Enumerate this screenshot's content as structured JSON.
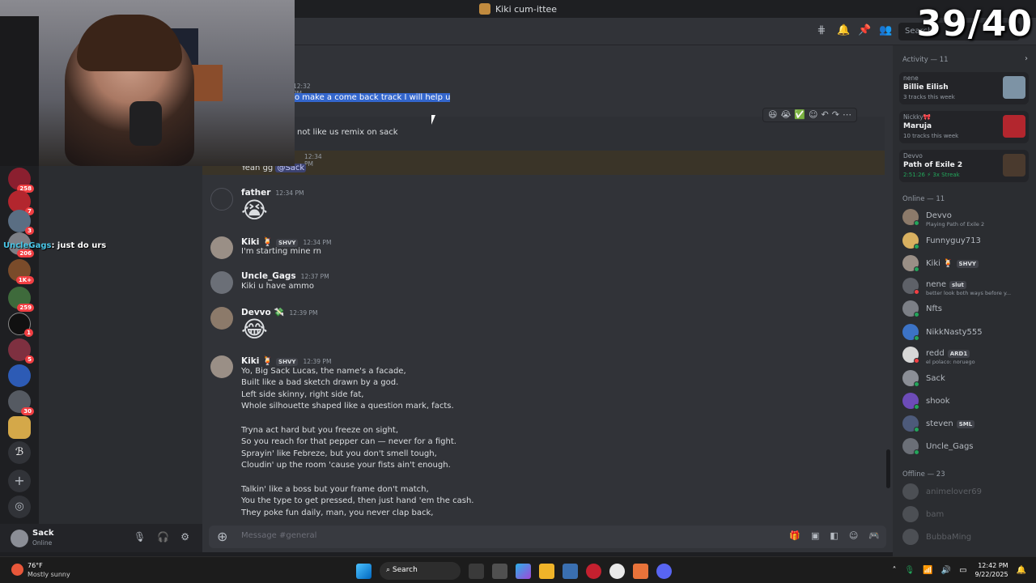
{
  "window": {
    "title": "Kiki cum-ittee"
  },
  "stream_counter": "39/40",
  "stream_chat": {
    "user": "UncleGags",
    "text": ": just do urs"
  },
  "header": {
    "search_placeholder": "Search"
  },
  "servers": [
    {
      "badge": "258"
    },
    {
      "badge": "7"
    },
    {
      "badge": "3"
    },
    {
      "badge": "206"
    },
    {
      "badge": "1K+"
    },
    {
      "badge": "259"
    },
    {
      "badge": "1"
    },
    {
      "badge": "5"
    },
    {
      "badge": ""
    },
    {
      "badge": "30"
    },
    {
      "badge": ""
    }
  ],
  "messages": {
    "partial1": {
      "time": "12:32 PM",
      "text": "o make a come back track I will help u"
    },
    "partial2": {
      "text": "not like us remix on sack"
    },
    "partial3": {
      "time": "12:34 PM",
      "text": "Yeah gg ",
      "mention": "@Sack"
    },
    "m1": {
      "author": "father",
      "time": "12:34 PM",
      "emoji": "😭"
    },
    "m2": {
      "author": "Kiki 🍹",
      "tag": "SHVY",
      "time": "12:34 PM",
      "text": "I'm starting mine rn"
    },
    "m3": {
      "author": "Uncle_Gags",
      "time": "12:37 PM",
      "text": "Kiki u have ammo"
    },
    "m4": {
      "author": "Devvo 💸",
      "time": "12:39 PM",
      "emoji": "😂"
    },
    "m5": {
      "author": "Kiki 🍹",
      "tag": "SHVY",
      "time": "12:39 PM",
      "lines": [
        "Yo, Big Sack Lucas, the name's a facade,",
        "Built like a bad sketch drawn by a god.",
        "Left side skinny, right side fat,",
        "Whole silhouette shaped like a question mark, facts.",
        "",
        "Tryna act hard but you freeze on sight,",
        "So you reach for that pepper can — never for a fight.",
        "Sprayin' like Febreze, but you don't smell tough,",
        "Cloudin' up the room 'cause your fists ain't enough.",
        "",
        "Talkin' like a boss but your frame don't match,",
        "You the type to get pressed, then just hand 'em the cash.",
        "They poke fun daily, man, you never clap back,"
      ]
    }
  },
  "composer": {
    "placeholder": "Message #general"
  },
  "user_panel": {
    "name": "Sack",
    "status": "Online"
  },
  "activity": {
    "heading": "Activity — 11",
    "items": [
      {
        "user": "nene",
        "title": "Billie Eilish",
        "sub": "3 tracks this week"
      },
      {
        "user": "Nickky🎀",
        "title": "Maruja",
        "sub": "10 tracks this week"
      },
      {
        "user": "Devvo",
        "title": "Path of Exile 2",
        "sub": "2:51:26 ⚡ 3x Streak"
      }
    ]
  },
  "members": {
    "online_heading": "Online — 11",
    "offline_heading": "Offline — 23",
    "online": [
      {
        "name": "Devvo",
        "sub": "Playing Path of Exile 2"
      },
      {
        "name": "Funnyguy713",
        "sub": ""
      },
      {
        "name": "Kiki 🍹",
        "tag": "SHVY",
        "sub": ""
      },
      {
        "name": "nene",
        "tag": "slut",
        "sub": "better look both ways before y..."
      },
      {
        "name": "Nfts",
        "sub": ""
      },
      {
        "name": "NikkNasty555",
        "sub": ""
      },
      {
        "name": "redd",
        "tag": "ARD1",
        "sub": "el polaco: noruego"
      },
      {
        "name": "Sack",
        "sub": ""
      },
      {
        "name": "shook",
        "sub": ""
      },
      {
        "name": "steven",
        "tag": "SML",
        "sub": ""
      },
      {
        "name": "Uncle_Gags",
        "sub": ""
      }
    ],
    "offline": [
      {
        "name": "animelover69"
      },
      {
        "name": "bam"
      },
      {
        "name": "BubbaMing"
      }
    ]
  },
  "taskbar": {
    "weather_temp": "76°F",
    "weather_desc": "Mostly sunny",
    "search": "Search",
    "time": "12:42 PM",
    "date": "9/22/2025"
  }
}
